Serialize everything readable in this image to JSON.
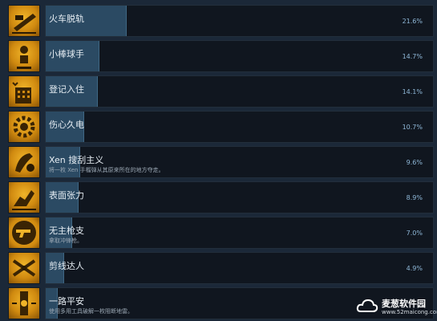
{
  "achievements": [
    {
      "name": "火车脱轨",
      "desc": "",
      "percent": "21.6%",
      "fill": 0.216,
      "icon": "train-derail-icon"
    },
    {
      "name": "小棒球手",
      "desc": "",
      "percent": "14.7%",
      "fill": 0.147,
      "icon": "baseball-player-icon"
    },
    {
      "name": "登记入住",
      "desc": "",
      "percent": "14.1%",
      "fill": 0.141,
      "icon": "hotel-checkin-icon"
    },
    {
      "name": "伤心久电",
      "desc": "",
      "percent": "10.7%",
      "fill": 0.107,
      "icon": "gear-heart-icon"
    },
    {
      "name": "Xen 搜刮主义",
      "desc": "将一枚 Xen 手榴弹从其原来所在的地方夺走。",
      "percent": "9.6%",
      "fill": 0.096,
      "icon": "xen-grenade-icon"
    },
    {
      "name": "表面张力",
      "desc": "",
      "percent": "8.9%",
      "fill": 0.089,
      "icon": "surface-tension-icon"
    },
    {
      "name": "无主枪支",
      "desc": "拿取冲锋枪。",
      "percent": "7.0%",
      "fill": 0.07,
      "icon": "pistol-icon"
    },
    {
      "name": "剪线达人",
      "desc": "",
      "percent": "4.9%",
      "fill": 0.049,
      "icon": "wire-cutter-icon"
    },
    {
      "name": "一路平安",
      "desc": "使用多用工具破解一枚阻断地雷。",
      "percent": "",
      "fill": 0.03,
      "icon": "tripmine-icon"
    }
  ],
  "watermark": {
    "title": "麦葱软件园",
    "url": "www.52maicong.com"
  }
}
